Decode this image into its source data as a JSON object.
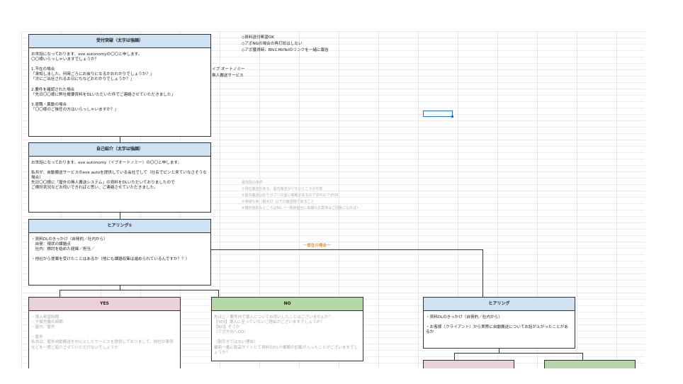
{
  "notes": {
    "line1": "◇資料送付希望OK",
    "line2": "◇アポNGの場合の再打診はしない",
    "line3": "◇アポ獲得時：BNとMiiTelのリンクを一緒に報告"
  },
  "company": {
    "name": "イブ オートノミー",
    "service": "無人搬送サービス"
  },
  "grey_notes": {
    "title": "最低限の条件",
    "items": [
      "①現在搬送がある、屋内搬送が少ないところが対象",
      "②屋内搬送以外でガブリの室に機種があるので許可のアポOK",
      "③導線も良（最大2）以下の搬送物であること",
      "④確定後的なところはNG（一発目担当に来期のお案件はご回答になれば）"
    ]
  },
  "branch_label": "一既往の場合一",
  "boxes": {
    "reception": {
      "header": "受付突破（太字は強調）",
      "body": "お世話になっております、eve autonomyの〇〇と申します。\n〇〇様いらっしゃいますでしょうか？\n\n1.不在の場合\n「承知しました。何時ごろにお戻りになるかおわかりでしょうか？」\n「次にご出社されるお日にちなどおわかりでしょうか？」\n\n2.要件を確認された場合\n「先日〇〇様に弊社概要資料をDLいただいた件でご連絡させていただきました」\n\n3.退職・異動の場合\n「〇〇様のご後任の方はいらっしゃいますか？」"
    },
    "intro": {
      "header": "自己紹介（太字は強調）",
      "body": "お世話になっております。eve autonomy（イブオートノミー）の〇〇と申します。\n\n私共が、自動搬送サービスのeve autoを提供している会社でして（社名でピンと来ていなさそうな場合）\n先日〇〇様に「屋外の無人搬送システム」の資料をDLいただいておりましたので\nご検討状況などお伺いできればと思い、ご連絡させていただきました。"
    },
    "hearing1": {
      "header": "ヒアリング①",
      "body": "・資料DLのきっかけ（自発的／社内から）\n　自発：現状の課題点\n　社内：検討を始めた経緯／担当／\n\n・他社から提案を受けたことはあるか（他にも課題収集は進められているんですか？？）"
    },
    "yes": {
      "header": "YES",
      "body": "・導入希望時期\n・予算労働の時期\n・屋内／屋外\n\n・屋外\n私共は、屋外自動搬送を中心としたサービスを提供しておりまして、他社の事例などを一度ご紹介させていただけないでしょうか"
    },
    "no": {
      "header": "NO",
      "body": "先ほど／要件内で導入についてお伺いしたことはございませんか？\n【YES】導入に至っていないご理由がございますでしょうか？\n【NO】そうか\n（アポ方向へGO）\n\n（割引きではない理由）\n最新一番に製品サイトにて資料のDLや書類の記載が入ったことがございますでしょうか？"
    },
    "hearing2": {
      "header": "ヒアリング",
      "body": "・資料DLのきっかけ（自発的／社内から）\n\n・お客様（クライアント）から実際に自動搬送についてお話が上がったことがあるか"
    }
  }
}
